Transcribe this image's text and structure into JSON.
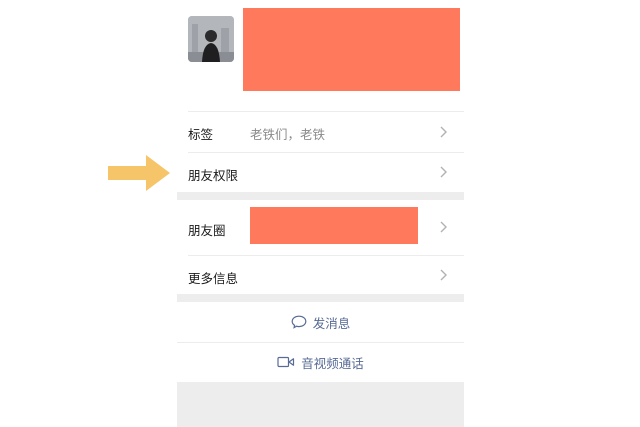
{
  "profile": {
    "avatar_icon": "avatar-photo"
  },
  "rows": {
    "tags_label": "标签",
    "tags_value": "老铁们，老铁",
    "permissions_label": "朋友权限",
    "moments_label": "朋友圈",
    "more_info_label": "更多信息"
  },
  "actions": {
    "message_label": "发消息",
    "message_icon": "chat-bubble-icon",
    "call_label": "音视频通话",
    "call_icon": "video-camera-icon"
  },
  "colors": {
    "redaction": "#ff7a5c",
    "arrow": "#f6c56a",
    "link": "#576b95",
    "separator": "#ededed"
  }
}
